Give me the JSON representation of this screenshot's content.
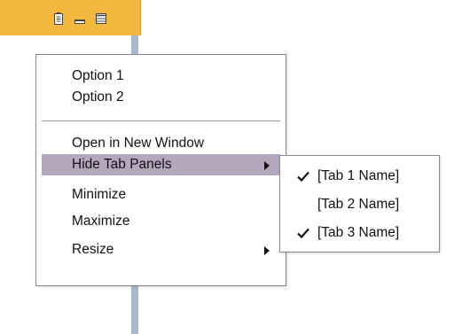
{
  "header": {
    "icons": [
      "document-icon",
      "minimize-icon",
      "maximize-icon"
    ],
    "accent_color": "#f3b83f"
  },
  "menu": {
    "items": [
      {
        "label": "Option 1"
      },
      {
        "label": "Option 2"
      },
      {
        "label": "Open in New Window"
      },
      {
        "label": "Hide Tab Panels",
        "has_submenu": true,
        "highlighted": true
      },
      {
        "label": "Minimize"
      },
      {
        "label": "Maximize"
      },
      {
        "label": "Resize",
        "has_submenu": true
      }
    ],
    "highlight_color": "#b4a7bd"
  },
  "submenu": {
    "items": [
      {
        "label": "[Tab 1 Name]",
        "checked": true
      },
      {
        "label": "[Tab 2 Name]",
        "checked": false
      },
      {
        "label": "[Tab 3 Name]",
        "checked": true
      }
    ]
  }
}
